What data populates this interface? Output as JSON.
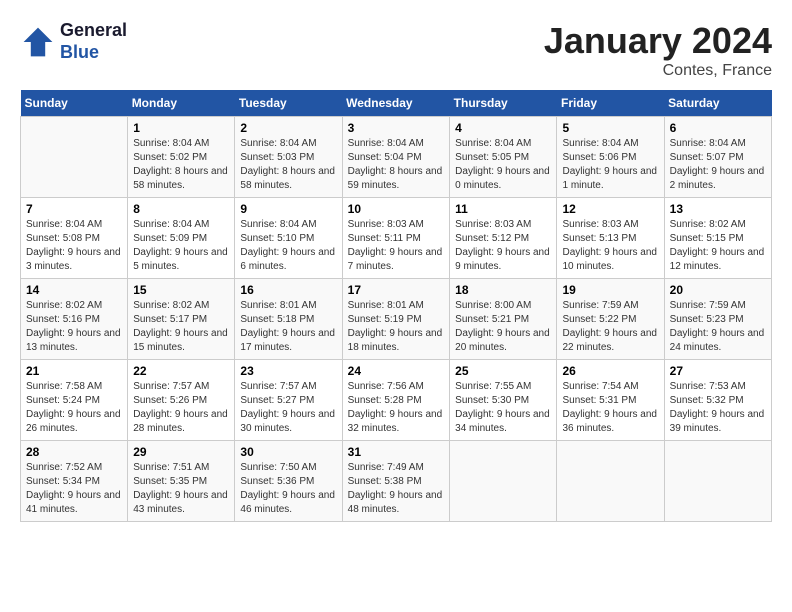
{
  "logo": {
    "line1": "General",
    "line2": "Blue"
  },
  "title": "January 2024",
  "subtitle": "Contes, France",
  "days_header": [
    "Sunday",
    "Monday",
    "Tuesday",
    "Wednesday",
    "Thursday",
    "Friday",
    "Saturday"
  ],
  "weeks": [
    [
      {
        "day": "",
        "sunrise": "",
        "sunset": "",
        "daylight": ""
      },
      {
        "day": "1",
        "sunrise": "Sunrise: 8:04 AM",
        "sunset": "Sunset: 5:02 PM",
        "daylight": "Daylight: 8 hours and 58 minutes."
      },
      {
        "day": "2",
        "sunrise": "Sunrise: 8:04 AM",
        "sunset": "Sunset: 5:03 PM",
        "daylight": "Daylight: 8 hours and 58 minutes."
      },
      {
        "day": "3",
        "sunrise": "Sunrise: 8:04 AM",
        "sunset": "Sunset: 5:04 PM",
        "daylight": "Daylight: 8 hours and 59 minutes."
      },
      {
        "day": "4",
        "sunrise": "Sunrise: 8:04 AM",
        "sunset": "Sunset: 5:05 PM",
        "daylight": "Daylight: 9 hours and 0 minutes."
      },
      {
        "day": "5",
        "sunrise": "Sunrise: 8:04 AM",
        "sunset": "Sunset: 5:06 PM",
        "daylight": "Daylight: 9 hours and 1 minute."
      },
      {
        "day": "6",
        "sunrise": "Sunrise: 8:04 AM",
        "sunset": "Sunset: 5:07 PM",
        "daylight": "Daylight: 9 hours and 2 minutes."
      }
    ],
    [
      {
        "day": "7",
        "sunrise": "Sunrise: 8:04 AM",
        "sunset": "Sunset: 5:08 PM",
        "daylight": "Daylight: 9 hours and 3 minutes."
      },
      {
        "day": "8",
        "sunrise": "Sunrise: 8:04 AM",
        "sunset": "Sunset: 5:09 PM",
        "daylight": "Daylight: 9 hours and 5 minutes."
      },
      {
        "day": "9",
        "sunrise": "Sunrise: 8:04 AM",
        "sunset": "Sunset: 5:10 PM",
        "daylight": "Daylight: 9 hours and 6 minutes."
      },
      {
        "day": "10",
        "sunrise": "Sunrise: 8:03 AM",
        "sunset": "Sunset: 5:11 PM",
        "daylight": "Daylight: 9 hours and 7 minutes."
      },
      {
        "day": "11",
        "sunrise": "Sunrise: 8:03 AM",
        "sunset": "Sunset: 5:12 PM",
        "daylight": "Daylight: 9 hours and 9 minutes."
      },
      {
        "day": "12",
        "sunrise": "Sunrise: 8:03 AM",
        "sunset": "Sunset: 5:13 PM",
        "daylight": "Daylight: 9 hours and 10 minutes."
      },
      {
        "day": "13",
        "sunrise": "Sunrise: 8:02 AM",
        "sunset": "Sunset: 5:15 PM",
        "daylight": "Daylight: 9 hours and 12 minutes."
      }
    ],
    [
      {
        "day": "14",
        "sunrise": "Sunrise: 8:02 AM",
        "sunset": "Sunset: 5:16 PM",
        "daylight": "Daylight: 9 hours and 13 minutes."
      },
      {
        "day": "15",
        "sunrise": "Sunrise: 8:02 AM",
        "sunset": "Sunset: 5:17 PM",
        "daylight": "Daylight: 9 hours and 15 minutes."
      },
      {
        "day": "16",
        "sunrise": "Sunrise: 8:01 AM",
        "sunset": "Sunset: 5:18 PM",
        "daylight": "Daylight: 9 hours and 17 minutes."
      },
      {
        "day": "17",
        "sunrise": "Sunrise: 8:01 AM",
        "sunset": "Sunset: 5:19 PM",
        "daylight": "Daylight: 9 hours and 18 minutes."
      },
      {
        "day": "18",
        "sunrise": "Sunrise: 8:00 AM",
        "sunset": "Sunset: 5:21 PM",
        "daylight": "Daylight: 9 hours and 20 minutes."
      },
      {
        "day": "19",
        "sunrise": "Sunrise: 7:59 AM",
        "sunset": "Sunset: 5:22 PM",
        "daylight": "Daylight: 9 hours and 22 minutes."
      },
      {
        "day": "20",
        "sunrise": "Sunrise: 7:59 AM",
        "sunset": "Sunset: 5:23 PM",
        "daylight": "Daylight: 9 hours and 24 minutes."
      }
    ],
    [
      {
        "day": "21",
        "sunrise": "Sunrise: 7:58 AM",
        "sunset": "Sunset: 5:24 PM",
        "daylight": "Daylight: 9 hours and 26 minutes."
      },
      {
        "day": "22",
        "sunrise": "Sunrise: 7:57 AM",
        "sunset": "Sunset: 5:26 PM",
        "daylight": "Daylight: 9 hours and 28 minutes."
      },
      {
        "day": "23",
        "sunrise": "Sunrise: 7:57 AM",
        "sunset": "Sunset: 5:27 PM",
        "daylight": "Daylight: 9 hours and 30 minutes."
      },
      {
        "day": "24",
        "sunrise": "Sunrise: 7:56 AM",
        "sunset": "Sunset: 5:28 PM",
        "daylight": "Daylight: 9 hours and 32 minutes."
      },
      {
        "day": "25",
        "sunrise": "Sunrise: 7:55 AM",
        "sunset": "Sunset: 5:30 PM",
        "daylight": "Daylight: 9 hours and 34 minutes."
      },
      {
        "day": "26",
        "sunrise": "Sunrise: 7:54 AM",
        "sunset": "Sunset: 5:31 PM",
        "daylight": "Daylight: 9 hours and 36 minutes."
      },
      {
        "day": "27",
        "sunrise": "Sunrise: 7:53 AM",
        "sunset": "Sunset: 5:32 PM",
        "daylight": "Daylight: 9 hours and 39 minutes."
      }
    ],
    [
      {
        "day": "28",
        "sunrise": "Sunrise: 7:52 AM",
        "sunset": "Sunset: 5:34 PM",
        "daylight": "Daylight: 9 hours and 41 minutes."
      },
      {
        "day": "29",
        "sunrise": "Sunrise: 7:51 AM",
        "sunset": "Sunset: 5:35 PM",
        "daylight": "Daylight: 9 hours and 43 minutes."
      },
      {
        "day": "30",
        "sunrise": "Sunrise: 7:50 AM",
        "sunset": "Sunset: 5:36 PM",
        "daylight": "Daylight: 9 hours and 46 minutes."
      },
      {
        "day": "31",
        "sunrise": "Sunrise: 7:49 AM",
        "sunset": "Sunset: 5:38 PM",
        "daylight": "Daylight: 9 hours and 48 minutes."
      },
      {
        "day": "",
        "sunrise": "",
        "sunset": "",
        "daylight": ""
      },
      {
        "day": "",
        "sunrise": "",
        "sunset": "",
        "daylight": ""
      },
      {
        "day": "",
        "sunrise": "",
        "sunset": "",
        "daylight": ""
      }
    ]
  ],
  "colors": {
    "header_bg": "#2255a4",
    "header_text": "#ffffff",
    "odd_row": "#f9f9f9",
    "even_row": "#ffffff"
  }
}
